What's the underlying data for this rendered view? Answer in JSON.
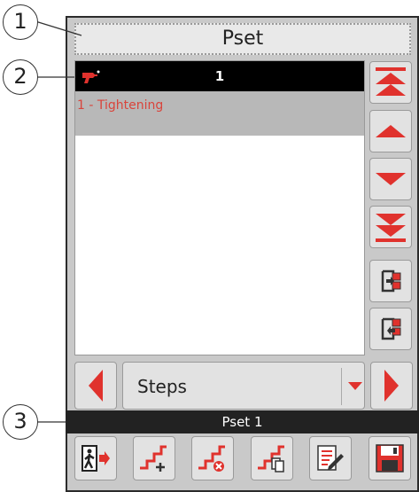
{
  "callouts": {
    "c1": "1",
    "c2": "2",
    "c3": "3"
  },
  "title": "Pset",
  "list": {
    "header_number": "1",
    "rows": [
      {
        "label": "1 - Tightening"
      }
    ]
  },
  "side_buttons": [
    "scroll-top-icon",
    "scroll-up-icon",
    "scroll-down-icon",
    "scroll-bottom-icon",
    "move-out-icon",
    "move-in-icon"
  ],
  "nav": {
    "select_label": "Steps"
  },
  "status": {
    "text": "Pset 1"
  },
  "toolbar": [
    "exit-icon",
    "add-step-icon",
    "delete-step-icon",
    "copy-step-icon",
    "edit-icon",
    "save-icon"
  ],
  "colors": {
    "accent_red": "#e0322d",
    "list_text": "#d9443b",
    "row_bg": "#b8b8b8",
    "bar_bg": "#222222"
  }
}
